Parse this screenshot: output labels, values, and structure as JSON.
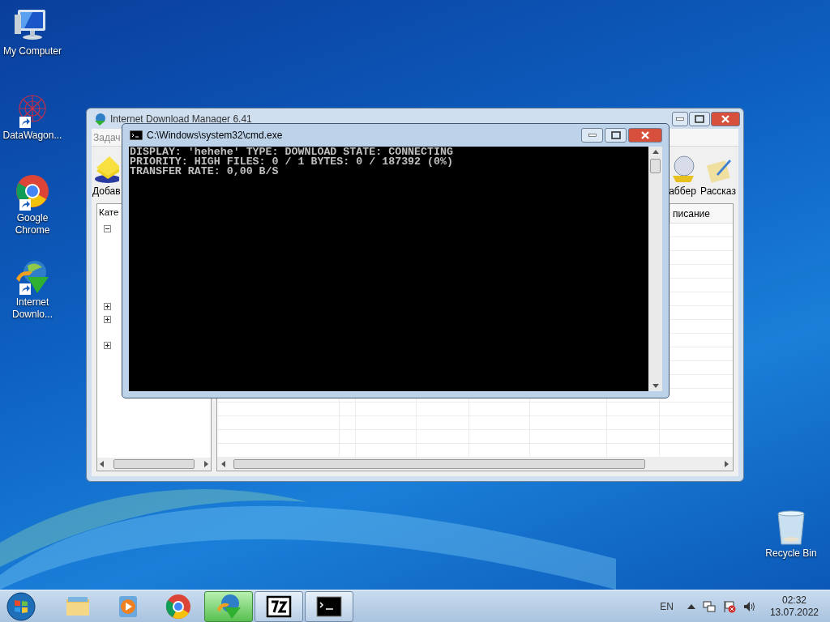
{
  "desktop_icons": [
    {
      "label": "My Computer",
      "kind": "computer",
      "shortcut": false
    },
    {
      "label": "DataWagon...",
      "kind": "datawagon",
      "shortcut": true
    },
    {
      "label": "Google Chrome",
      "kind": "chrome",
      "shortcut": true
    },
    {
      "label": "Internet Downlo...",
      "kind": "idm",
      "shortcut": true
    },
    {
      "label": "Recycle Bin",
      "kind": "bin",
      "shortcut": false
    }
  ],
  "idm_window": {
    "title": "Internet Download Manager 6.41",
    "menu": [
      "Задач"
    ],
    "toolbar_left": "Добав",
    "toolbar_right": [
      "аббер",
      "Рассказ"
    ],
    "tree_header": "Кате",
    "column_header": "писание"
  },
  "cmd_window": {
    "title": "C:\\Windows\\system32\\cmd.exe",
    "lines": [
      "DISPLAY: 'hehehe' TYPE: DOWNLOAD STATE: CONNECTING",
      "PRIORITY: HIGH FILES: 0 / 1 BYTES: 0 / 187392 (0%)",
      "TRANSFER RATE: 0,00 B/S"
    ]
  },
  "taskbar": {
    "items": [
      {
        "kind": "explorer",
        "running": false,
        "active": false
      },
      {
        "kind": "media",
        "running": false,
        "active": false
      },
      {
        "kind": "chrome",
        "running": false,
        "active": false
      },
      {
        "kind": "idm",
        "running": true,
        "active": true
      },
      {
        "kind": "archiver",
        "running": true,
        "active": false
      },
      {
        "kind": "cmd",
        "running": true,
        "active": false
      }
    ],
    "language": "EN",
    "time": "02:32",
    "date": "13.07.2022"
  }
}
